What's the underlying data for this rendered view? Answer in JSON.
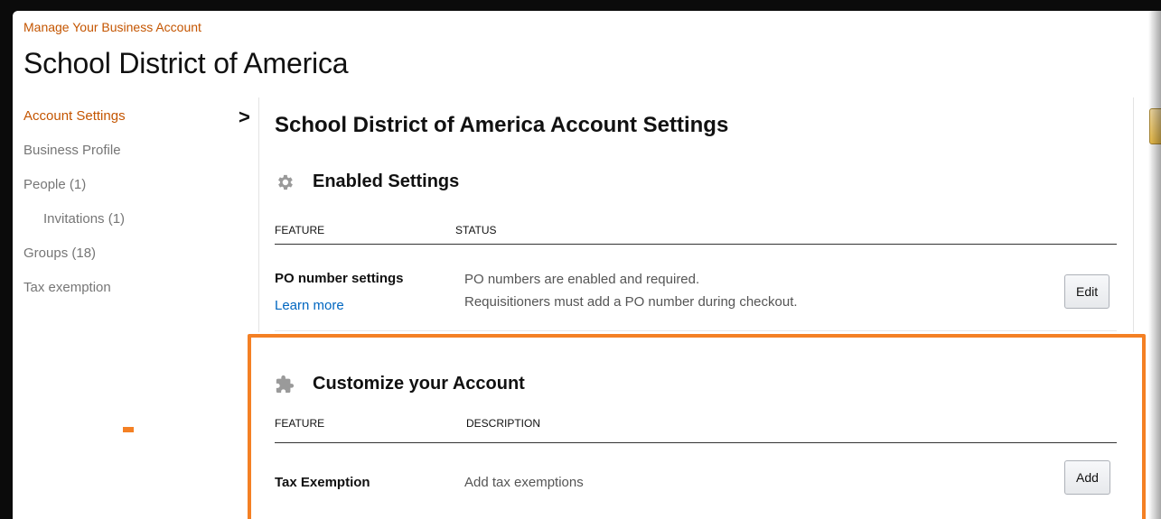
{
  "breadcrumb": "Manage Your Business Account",
  "page_title": "School District of America",
  "sidebar": {
    "items": [
      {
        "label": "Account Settings",
        "active": true
      },
      {
        "label": "Business Profile"
      },
      {
        "label": "People (1)"
      },
      {
        "label": "Invitations (1)"
      },
      {
        "label": "Groups (18)"
      },
      {
        "label": "Tax exemption"
      }
    ],
    "chevron": "›"
  },
  "main": {
    "title": "School District of America  Account Settings",
    "enabled": {
      "title": "Enabled Settings",
      "icon": "gear-icon",
      "col_feature": "FEATURE",
      "col_status": "STATUS",
      "row": {
        "name": "PO number settings",
        "link": "Learn more",
        "status_line1": "PO numbers are enabled and required.",
        "status_line2": "Requisitioners must add a PO number during checkout.",
        "button": "Edit"
      }
    },
    "customize": {
      "title": "Customize your Account",
      "icon": "puzzle-icon",
      "col_feature": "FEATURE",
      "col_description": "DESCRIPTION",
      "row": {
        "name": "Tax Exemption",
        "description": "Add tax exemptions",
        "button": "Add"
      }
    }
  },
  "colors": {
    "accent": "#c45500",
    "highlight": "#f48024",
    "link": "#0066c0"
  }
}
